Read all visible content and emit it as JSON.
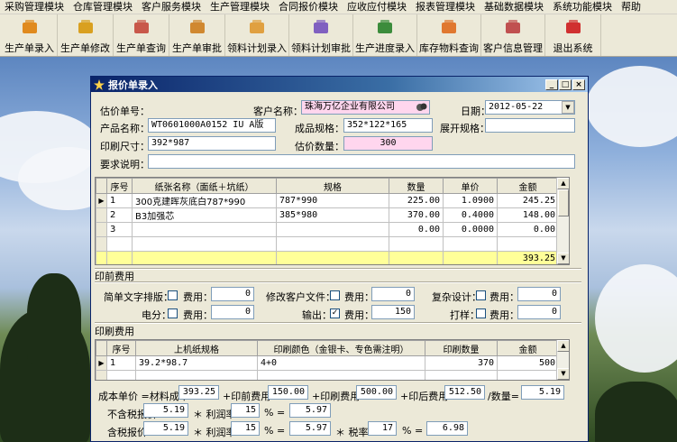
{
  "menu": [
    "采购管理模块",
    "仓库管理模块",
    "客户服务模块",
    "生产管理模块",
    "合同报价模块",
    "应收应付模块",
    "报表管理模块",
    "基础数据模块",
    "系统功能模块",
    "帮助"
  ],
  "toolbar": [
    {
      "label": "生产单录入",
      "icon": "box-icon",
      "color": "#e08a1e"
    },
    {
      "label": "生产单修改",
      "icon": "box-edit-icon",
      "color": "#d9a020"
    },
    {
      "label": "生产单查询",
      "icon": "people-icon",
      "color": "#c8584a"
    },
    {
      "label": "生产单审批",
      "icon": "hand-icon",
      "color": "#d08830"
    },
    {
      "label": "领料计划录入",
      "icon": "pencil-icon",
      "color": "#e0a040"
    },
    {
      "label": "领料计划审批",
      "icon": "bottles-icon",
      "color": "#8060c0"
    },
    {
      "label": "生产进度录入",
      "icon": "chart-icon",
      "color": "#3c8c3c"
    },
    {
      "label": "库存物料查询",
      "icon": "box-search-icon",
      "color": "#e07830"
    },
    {
      "label": "客户信息管理",
      "icon": "users-icon",
      "color": "#c05050"
    },
    {
      "label": "退出系统",
      "icon": "exit-icon",
      "color": "#d03030"
    }
  ],
  "window": {
    "title": "报价单录入",
    "btn_min": "_",
    "btn_max": "□",
    "btn_close": "×"
  },
  "form": {
    "quote_no_label": "估价单号：",
    "quote_no": "",
    "customer_label": "客户名称：",
    "customer": "珠海万亿企业有限公司",
    "date_label": "日期：",
    "date": "2012-05-22",
    "product_label": "产品名称：",
    "product": "WT0601000A0152  IU  A版",
    "finished_spec_label": "成品规格：",
    "finished_spec": "352*122*165",
    "unfold_spec_label": "展开规格：",
    "unfold_spec": "",
    "print_size_label": "印刷尺寸：",
    "print_size": "392*987",
    "quote_qty_label": "估价数量：",
    "quote_qty": "300",
    "remark_label": "要求说明：",
    "remark": ""
  },
  "paper_grid": {
    "headers": [
      "序号",
      "纸张名称（面纸＋坑纸）",
      "规格",
      "数量",
      "单价",
      "金额"
    ],
    "rows": [
      [
        "1",
        "300克建晖灰底白787*990",
        "787*990",
        "225.00",
        "1.0900",
        "245.25"
      ],
      [
        "2",
        "B3加强芯",
        "385*980",
        "370.00",
        "0.4000",
        "148.00"
      ],
      [
        "3",
        "",
        "",
        "0.00",
        "0.0000",
        "0.00"
      ],
      [
        "",
        "",
        "",
        "",
        "",
        ""
      ]
    ],
    "total": "393.25"
  },
  "print_fee": {
    "header": "印前费用",
    "simple_text_label": "简单文字排版：",
    "fee_label": "费用：",
    "simple_fee": "0",
    "modify_file_label": "修改客户文件：",
    "modify_fee": "0",
    "complex_label": "复杂设计：",
    "complex_fee": "0",
    "electric_label": "电分：",
    "electric_fee": "0",
    "output_label": "输出：",
    "output_fee": "150",
    "proof_label": "打样：",
    "proof_fee": "0",
    "output_checked": "✓"
  },
  "printing_grid": {
    "header": "印刷费用",
    "headers": [
      "序号",
      "上机纸规格",
      "印刷颜色（金银卡、专色需注明）",
      "印刷数量",
      "金额"
    ],
    "rows": [
      [
        "1",
        "39.2*98.7",
        "4+0",
        "370",
        "500"
      ],
      [
        "",
        "",
        "",
        "",
        ""
      ]
    ]
  },
  "summary": {
    "cost_label": "成本单价 =材料成本",
    "material_cost": "393.25",
    "preprint_label": "+印前费用",
    "preprint_cost": "150.00",
    "print_label": "+印刷费用",
    "print_cost": "500.00",
    "postprint_label": "+印后费用",
    "postprint_cost": "512.50",
    "divide_label": "/数量=",
    "unit_cost": "5.19",
    "notax_label": "不含税报价",
    "notax_base": "5.19",
    "mult_profit_label": "＊ 利润率",
    "profit_rate": "15",
    "percent_eq": "%  =",
    "notax_price": "5.97",
    "tax_label": "含税报价",
    "tax_base": "5.19",
    "profit_rate2": "15",
    "tax_mid": "5.97",
    "tax_rate_label": "＊ 税率",
    "tax_rate": "17",
    "tax_price": "6.98"
  }
}
